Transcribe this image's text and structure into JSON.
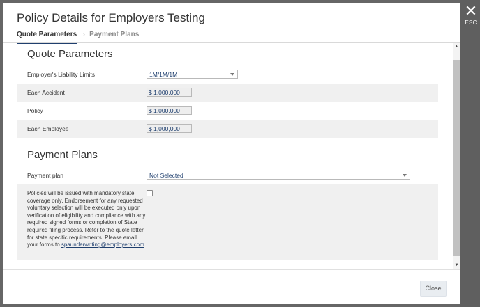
{
  "overlay": {
    "esc_label": "ESC"
  },
  "modal": {
    "title": "Policy Details for Employers Testing",
    "tabs": [
      {
        "label": "Quote Parameters",
        "active": true
      },
      {
        "label": "Payment Plans",
        "active": false
      }
    ]
  },
  "quote_parameters": {
    "heading": "Quote Parameters",
    "fields": [
      {
        "label": "Employer's Liability Limits",
        "value": "1M/1M/1M"
      },
      {
        "label": "Each Accident",
        "value": "$ 1,000,000"
      },
      {
        "label": "Policy",
        "value": "$ 1,000,000"
      },
      {
        "label": "Each Employee",
        "value": "$ 1,000,000"
      }
    ]
  },
  "payment_plans": {
    "heading": "Payment Plans",
    "plan_label": "Payment plan",
    "plan_value": "Not Selected",
    "notice_text": "Policies will be issued with mandatory state coverage only. Endorsement for any requested voluntary selection will be executed only upon verification of eligibility and compliance with any required signed forms or completion of State required filing process. Refer to the quote letter for state specific requirements. Please email your forms to ",
    "notice_email": "spaunderwriting@employers.com",
    "notice_end": "."
  },
  "footer": {
    "close_label": "Close"
  },
  "colors": {
    "accent": "#1f3f6e",
    "shade": "#f0f0f0",
    "close_button_bg": "#e9edf1"
  }
}
